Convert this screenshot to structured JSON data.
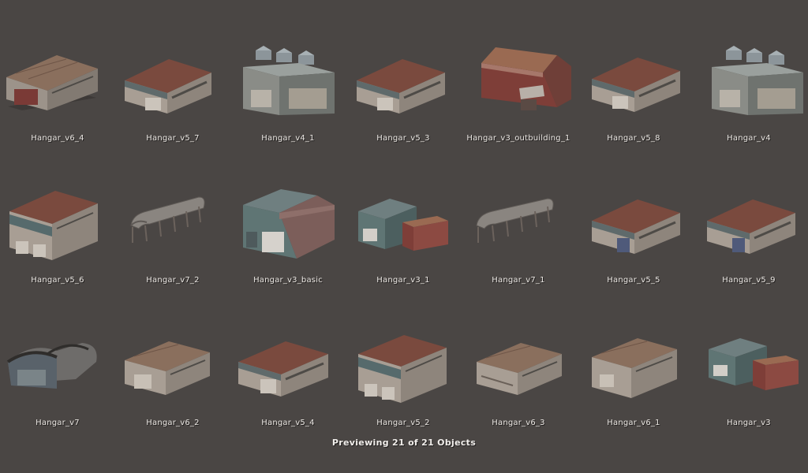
{
  "objects": [
    {
      "name": "Hangar_v6_4",
      "icon": "hangar-long-icon"
    },
    {
      "name": "Hangar_v5_7",
      "icon": "hangar-gable-icon"
    },
    {
      "name": "Hangar_v4_1",
      "icon": "hangar-roof-units-icon"
    },
    {
      "name": "Hangar_v5_3",
      "icon": "hangar-gable-icon"
    },
    {
      "name": "Hangar_v3_outbuilding_1",
      "icon": "hangar-red-shed-icon"
    },
    {
      "name": "Hangar_v5_8",
      "icon": "hangar-gable-icon"
    },
    {
      "name": "Hangar_v4",
      "icon": "hangar-roof-units-icon"
    },
    {
      "name": "Hangar_v5_6",
      "icon": "hangar-two-storey-icon"
    },
    {
      "name": "Hangar_v7_2",
      "icon": "hangar-frame-icon"
    },
    {
      "name": "Hangar_v3_basic",
      "icon": "hangar-teal-gable-icon"
    },
    {
      "name": "Hangar_v3_1",
      "icon": "hangar-twin-shed-icon"
    },
    {
      "name": "Hangar_v7_1",
      "icon": "hangar-frame-icon"
    },
    {
      "name": "Hangar_v5_5",
      "icon": "hangar-gable-icon"
    },
    {
      "name": "Hangar_v5_9",
      "icon": "hangar-gable-icon"
    },
    {
      "name": "Hangar_v7",
      "icon": "hangar-quonset-icon"
    },
    {
      "name": "Hangar_v6_2",
      "icon": "hangar-long-icon"
    },
    {
      "name": "Hangar_v5_4",
      "icon": "hangar-gable-icon"
    },
    {
      "name": "Hangar_v5_2",
      "icon": "hangar-two-storey-icon"
    },
    {
      "name": "Hangar_v6_3",
      "icon": "hangar-long-icon"
    },
    {
      "name": "Hangar_v6_1",
      "icon": "hangar-long-icon"
    },
    {
      "name": "Hangar_v3",
      "icon": "hangar-twin-shed-icon"
    }
  ],
  "status": {
    "text": "Previewing 21 of 21 Objects"
  },
  "colors": {
    "background": "#4a4644",
    "label_text": "#ece8e4",
    "roof_rust": "#7a4a3e",
    "wall_concrete": "#a89e94",
    "wall_teal": "#5f7574"
  }
}
